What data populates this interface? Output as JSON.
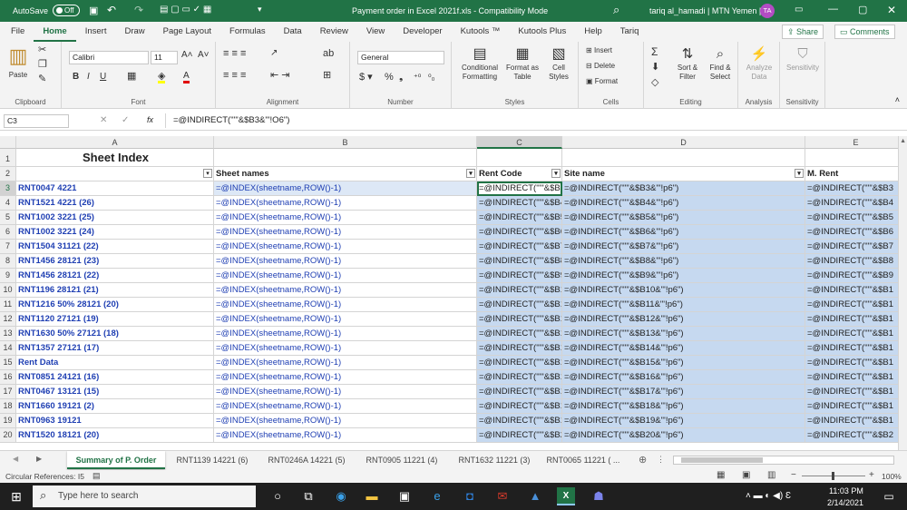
{
  "titlebar": {
    "autosave_label": "AutoSave",
    "autosave_state": "Off",
    "title": "Payment order in Excel 2021f.xls  -  Compatibility Mode",
    "user": "tariq al_hamadi | MTN Yemen |",
    "user_initials": "TA"
  },
  "menu": [
    "File",
    "Home",
    "Insert",
    "Draw",
    "Page Layout",
    "Formulas",
    "Data",
    "Review",
    "View",
    "Developer",
    "Kutools ™",
    "Kutools Plus",
    "Help",
    "Tariq"
  ],
  "share_label": "Share",
  "comments_label": "Comments",
  "ribbon": {
    "paste": "Paste",
    "clipboard": "Clipboard",
    "font_name": "Calibri",
    "font_size": "11",
    "font": "Font",
    "alignment": "Alignment",
    "number_format": "General",
    "number": "Number",
    "conditional_formatting": "Conditional Formatting",
    "format_as_table": "Format as Table",
    "cell_styles": "Cell Styles",
    "styles": "Styles",
    "insert": "Insert",
    "delete": "Delete",
    "format": "Format",
    "cells": "Cells",
    "sort_filter": "Sort & Filter",
    "find_select": "Find & Select",
    "editing": "Editing",
    "analyze_data": "Analyze Data",
    "analysis": "Analysis",
    "sensitivity": "Sensitivity",
    "sensitivity_group": "Sensitivity"
  },
  "formula_bar": {
    "name_box": "C3",
    "fx": "fx",
    "formula": "=@INDIRECT(\"'\"&$B3&\"'!O6\")"
  },
  "columns": [
    "A",
    "B",
    "C",
    "D",
    "E"
  ],
  "headers": {
    "a1": "Sheet Index",
    "b": "Sheet names",
    "c": "Rent Code",
    "d": "Site name",
    "e": "M. Rent"
  },
  "rows": [
    {
      "n": "3",
      "a": "RNT0047 4221",
      "b": "=@INDEX(sheetname,ROW()-1)",
      "c": "=@INDIRECT(\"'\"&$B",
      "d": "=@INDIRECT(\"'\"&$B3&\"'!p6\")",
      "e": "=@INDIRECT(\"'\"&$B3"
    },
    {
      "n": "4",
      "a": "RNT1521 4221 (26)",
      "b": "=@INDEX(sheetname,ROW()-1)",
      "c": "=@INDIRECT(\"'\"&$B4",
      "d": "=@INDIRECT(\"'\"&$B4&\"'!p6\")",
      "e": "=@INDIRECT(\"'\"&$B4"
    },
    {
      "n": "5",
      "a": "RNT1002  3221 (25)",
      "b": "=@INDEX(sheetname,ROW()-1)",
      "c": "=@INDIRECT(\"'\"&$B5",
      "d": "=@INDIRECT(\"'\"&$B5&\"'!p6\")",
      "e": "=@INDIRECT(\"'\"&$B5"
    },
    {
      "n": "6",
      "a": "RNT1002  3221 (24)",
      "b": "=@INDEX(sheetname,ROW()-1)",
      "c": "=@INDIRECT(\"'\"&$B6",
      "d": "=@INDIRECT(\"'\"&$B6&\"'!p6\")",
      "e": "=@INDIRECT(\"'\"&$B6"
    },
    {
      "n": "7",
      "a": "RNT1504  31121 (22)",
      "b": "=@INDEX(sheetname,ROW()-1)",
      "c": "=@INDIRECT(\"'\"&$B7",
      "d": "=@INDIRECT(\"'\"&$B7&\"'!p6\")",
      "e": "=@INDIRECT(\"'\"&$B7"
    },
    {
      "n": "8",
      "a": "RNT1456  28121 (23)",
      "b": "=@INDEX(sheetname,ROW()-1)",
      "c": "=@INDIRECT(\"'\"&$B8",
      "d": "=@INDIRECT(\"'\"&$B8&\"'!p6\")",
      "e": "=@INDIRECT(\"'\"&$B8"
    },
    {
      "n": "9",
      "a": "RNT1456  28121 (22)",
      "b": "=@INDEX(sheetname,ROW()-1)",
      "c": "=@INDIRECT(\"'\"&$B9",
      "d": "=@INDIRECT(\"'\"&$B9&\"'!p6\")",
      "e": "=@INDIRECT(\"'\"&$B9"
    },
    {
      "n": "10",
      "a": "RNT1196  28121 (21)",
      "b": "=@INDEX(sheetname,ROW()-1)",
      "c": "=@INDIRECT(\"'\"&$B1",
      "d": "=@INDIRECT(\"'\"&$B10&\"'!p6\")",
      "e": "=@INDIRECT(\"'\"&$B1"
    },
    {
      "n": "11",
      "a": "RNT1216 50%  28121 (20)",
      "b": "=@INDEX(sheetname,ROW()-1)",
      "c": "=@INDIRECT(\"'\"&$B1",
      "d": "=@INDIRECT(\"'\"&$B11&\"'!p6\")",
      "e": "=@INDIRECT(\"'\"&$B1"
    },
    {
      "n": "12",
      "a": "RNT1120  27121 (19)",
      "b": "=@INDEX(sheetname,ROW()-1)",
      "c": "=@INDIRECT(\"'\"&$B1",
      "d": "=@INDIRECT(\"'\"&$B12&\"'!p6\")",
      "e": "=@INDIRECT(\"'\"&$B1"
    },
    {
      "n": "13",
      "a": "RNT1630 50%  27121 (18)",
      "b": "=@INDEX(sheetname,ROW()-1)",
      "c": "=@INDIRECT(\"'\"&$B1",
      "d": "=@INDIRECT(\"'\"&$B13&\"'!p6\")",
      "e": "=@INDIRECT(\"'\"&$B1"
    },
    {
      "n": "14",
      "a": "RNT1357  27121 (17)",
      "b": "=@INDEX(sheetname,ROW()-1)",
      "c": "=@INDIRECT(\"'\"&$B1",
      "d": "=@INDIRECT(\"'\"&$B14&\"'!p6\")",
      "e": "=@INDIRECT(\"'\"&$B1"
    },
    {
      "n": "15",
      "a": "Rent Data",
      "b": "=@INDEX(sheetname,ROW()-1)",
      "c": "=@INDIRECT(\"'\"&$B1",
      "d": "=@INDIRECT(\"'\"&$B15&\"'!p6\")",
      "e": "=@INDIRECT(\"'\"&$B1"
    },
    {
      "n": "16",
      "a": "RNT0851 24121 (16)",
      "b": "=@INDEX(sheetname,ROW()-1)",
      "c": "=@INDIRECT(\"'\"&$B1",
      "d": "=@INDIRECT(\"'\"&$B16&\"'!p6\")",
      "e": "=@INDIRECT(\"'\"&$B1"
    },
    {
      "n": "17",
      "a": "RNT0467 13121 (15)",
      "b": "=@INDEX(sheetname,ROW()-1)",
      "c": "=@INDIRECT(\"'\"&$B1",
      "d": "=@INDIRECT(\"'\"&$B17&\"'!p6\")",
      "e": "=@INDIRECT(\"'\"&$B1"
    },
    {
      "n": "18",
      "a": "RNT1660 19121 (2)",
      "b": "=@INDEX(sheetname,ROW()-1)",
      "c": "=@INDIRECT(\"'\"&$B1",
      "d": "=@INDIRECT(\"'\"&$B18&\"'!p6\")",
      "e": "=@INDIRECT(\"'\"&$B1"
    },
    {
      "n": "19",
      "a": "RNT0963 19121",
      "b": "=@INDEX(sheetname,ROW()-1)",
      "c": "=@INDIRECT(\"'\"&$B1",
      "d": "=@INDIRECT(\"'\"&$B19&\"'!p6\")",
      "e": "=@INDIRECT(\"'\"&$B1"
    },
    {
      "n": "20",
      "a": "RNT1520 18121 (20)",
      "b": "=@INDEX(sheetname,ROW()-1)",
      "c": "=@INDIRECT(\"'\"&$B2",
      "d": "=@INDIRECT(\"'\"&$B20&\"'!p6\")",
      "e": "=@INDIRECT(\"'\"&$B2"
    }
  ],
  "sheet_tabs": [
    "Summary of P. Order",
    "RNT1139 14221 (6)",
    "RNT0246A 14221 (5)",
    "RNT0905 11221 (4)",
    "RNT1632 11221 (3)",
    "RNT0065 11221 ( ..."
  ],
  "status": {
    "left": "Circular References: I5",
    "zoom": "100%"
  },
  "taskbar": {
    "search_placeholder": "Type here to search",
    "time": "11:03 PM",
    "date": "2/14/2021"
  },
  "colors": {
    "excel_green": "#217346",
    "selection_fill": "#c6d9f0",
    "link_blue": "#1f3fb3"
  }
}
